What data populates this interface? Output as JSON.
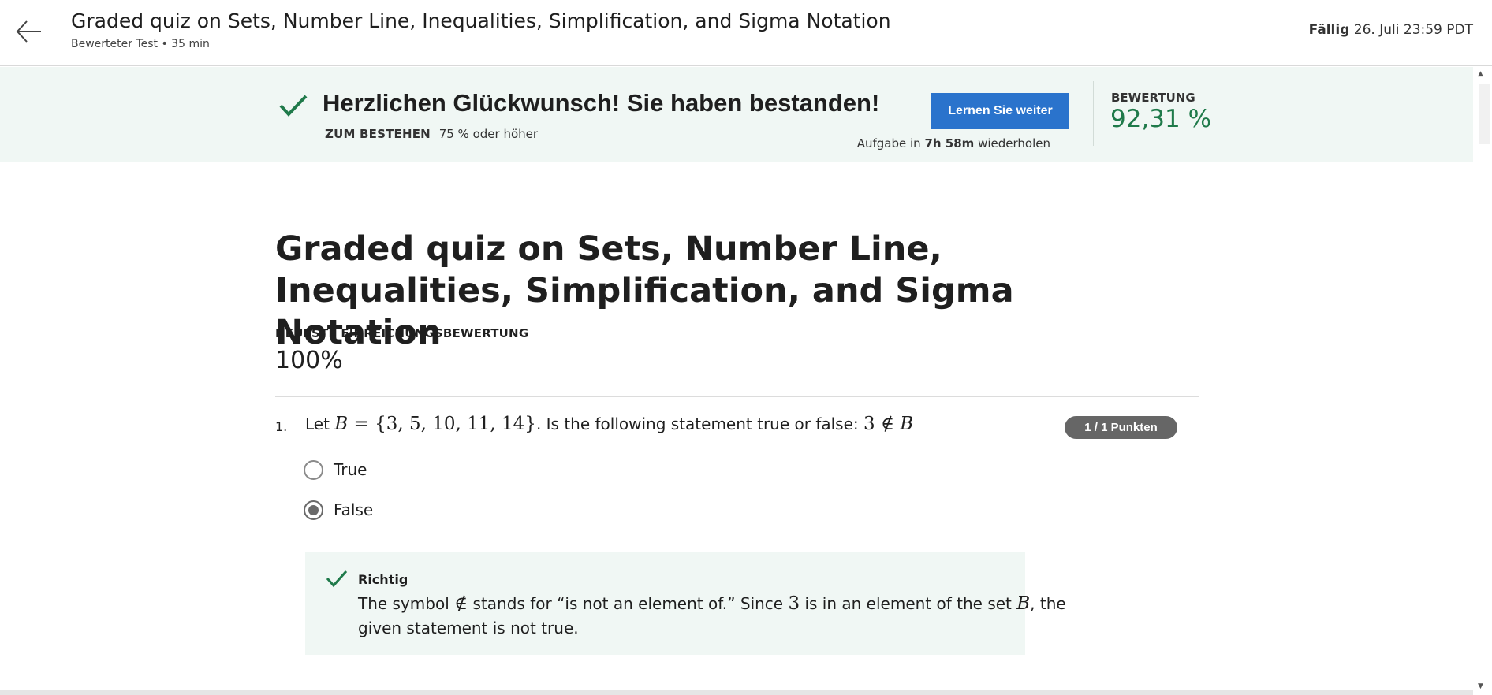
{
  "header": {
    "title": "Graded quiz on Sets, Number Line, Inequalities, Simplification, and Sigma Notation",
    "subtitle": "Bewerteter Test • 35 min",
    "due_label": "Fällig",
    "due_value": "26. Juli 23:59 PDT",
    "back_icon": "arrow-left-icon"
  },
  "banner": {
    "title": "Herzlichen Glückwunsch! Sie haben bestanden!",
    "pass_label": "ZUM BESTEHEN",
    "pass_value": "75 % oder höher",
    "continue_button": "Lernen Sie weiter",
    "retry_prefix": "Aufgabe in",
    "retry_time": "7h 58m",
    "retry_suffix": "wiederholen",
    "grade_label": "BEWERTUNG",
    "grade_value": "92,31 %",
    "check_icon": "checkmark-icon",
    "colors": {
      "background": "#f0f7f4",
      "accent_green": "#1f7a4a",
      "button_blue": "#2a73cc"
    }
  },
  "main": {
    "title": "Graded quiz on Sets, Number Line, Inequalities, Simplification, and Sigma Notation",
    "latest_label": "NEUESTE EINREICHUNGSBEWERTUNG",
    "latest_value": "100%"
  },
  "question": {
    "number": "1.",
    "text_prefix": "Let",
    "math_set_var": "B",
    "math_eq": " = ",
    "math_set": "{3, 5, 10, 11, 14}",
    "text_middle": ". Is the following statement true or false:",
    "math_statement_num": "3",
    "math_statement_op": " ∉ ",
    "math_statement_var": "B",
    "points": "1 / 1 Punkten",
    "options": [
      {
        "label": "True",
        "selected": false
      },
      {
        "label": "False",
        "selected": true
      }
    ]
  },
  "feedback": {
    "status": "Richtig",
    "text_1": "The symbol",
    "symbol": "∉",
    "text_2": "stands for “is not an element of.” Since",
    "num": "3",
    "text_3": "is in an element of the set",
    "set_var": "B",
    "text_4": ", the given statement is not true.",
    "icon": "checkmark-icon"
  }
}
